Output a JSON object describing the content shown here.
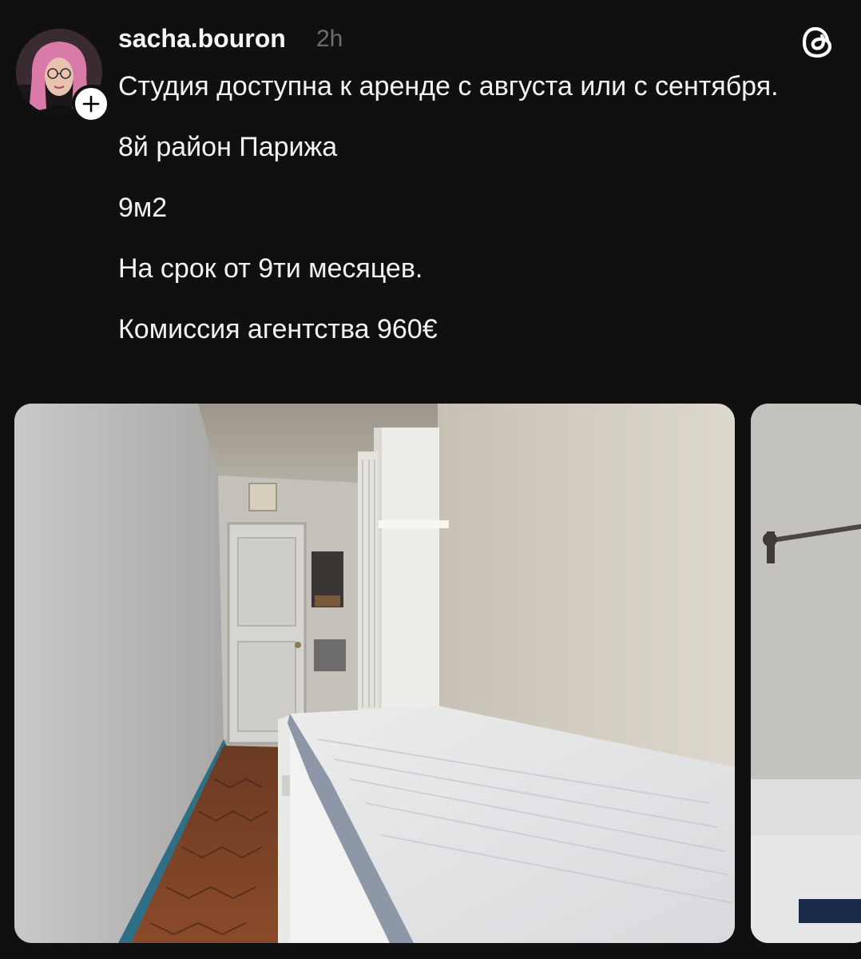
{
  "post": {
    "author": {
      "username": "sacha.bouron",
      "time": "2h",
      "avatar_icon": "user-avatar"
    },
    "follow_icon": "plus-icon",
    "app_icon": "threads-logo-icon",
    "paragraphs": [
      "Студия доступна к аренде с августа или с сентября.",
      "8й район Парижа",
      "9м2",
      "На срок от 9ти месяцев.",
      "Комиссия агентства 960€"
    ],
    "photos": [
      {
        "subject": "narrow-studio-room-with-bed"
      },
      {
        "subject": "bathroom-partial"
      }
    ]
  },
  "colors": {
    "background": "#101010",
    "text": "#f3f3f3",
    "muted": "#6d6d6d"
  }
}
